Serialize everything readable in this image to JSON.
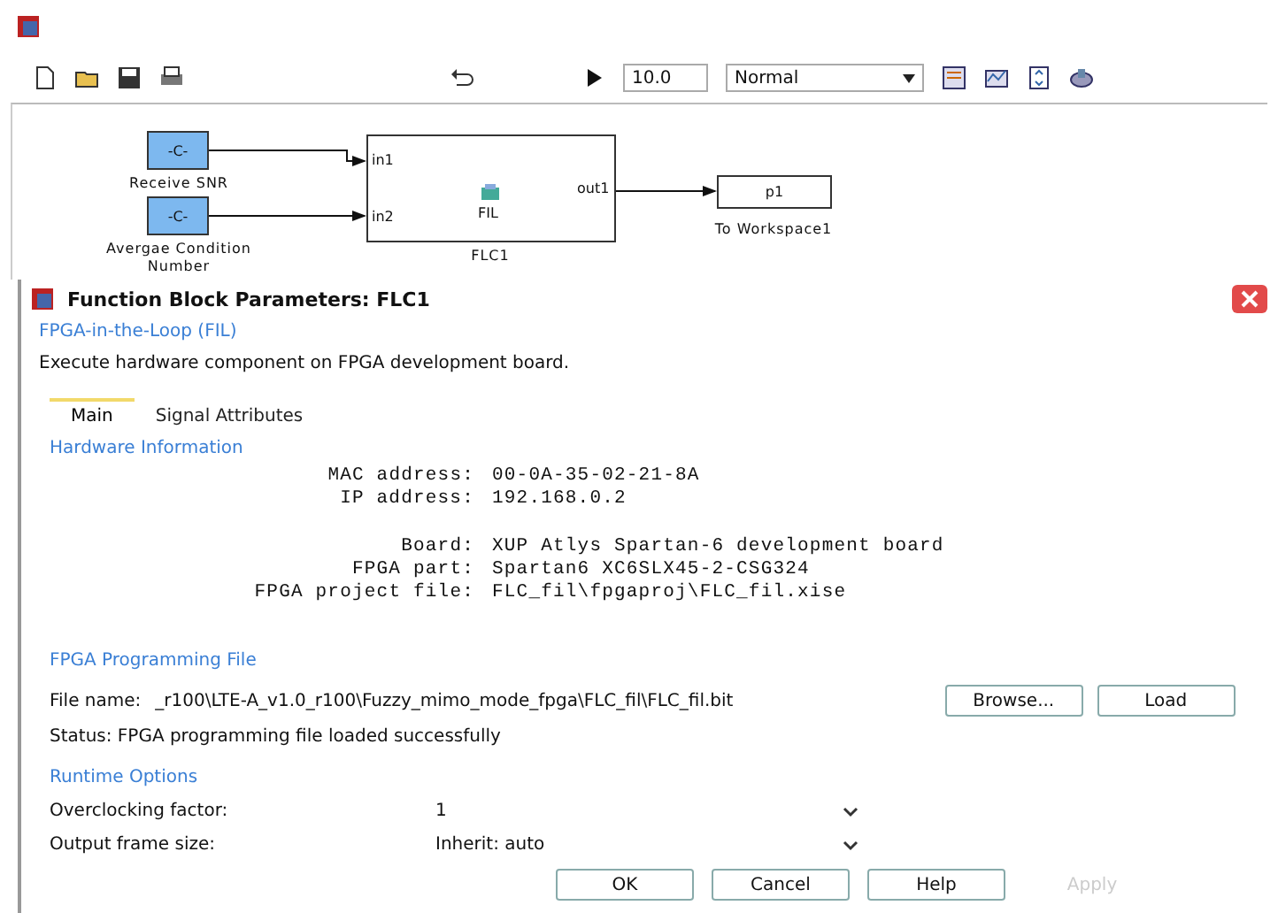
{
  "toolbar": {
    "stop_time": "10.0",
    "sim_mode": "Normal"
  },
  "model": {
    "blocks": [
      {
        "kind": "constant",
        "text": "-C-",
        "label": "Receive SNR"
      },
      {
        "kind": "constant",
        "text": "-C-",
        "label": "Avergae Condition Number"
      },
      {
        "kind": "subsystem",
        "ports_in": [
          "in1",
          "in2"
        ],
        "ports_out": [
          "out1"
        ],
        "icon_label": "FIL",
        "label": "FLC1"
      },
      {
        "kind": "workspace",
        "text": "p1",
        "label": "To Workspace1"
      }
    ]
  },
  "dialog": {
    "title": "Function Block Parameters: FLC1",
    "block_type": "FPGA-in-the-Loop (FIL)",
    "description": "Execute hardware component on FPGA development board.",
    "tabs": [
      {
        "label": "Main",
        "selected": true
      },
      {
        "label": "Signal Attributes",
        "selected": false
      }
    ],
    "hardware": {
      "heading": "Hardware Information",
      "groups": [
        [
          {
            "label": "MAC address:",
            "value": "00-0A-35-02-21-8A"
          },
          {
            "label": "IP address:",
            "value": "192.168.0.2"
          }
        ],
        [
          {
            "label": "Board:",
            "value": "XUP Atlys Spartan-6 development board"
          },
          {
            "label": "FPGA part:",
            "value": "Spartan6 XC6SLX45-2-CSG324"
          },
          {
            "label": "FPGA project file:",
            "value": "FLC_fil\\fpgaproj\\FLC_fil.xise"
          }
        ]
      ]
    },
    "programming": {
      "heading": "FPGA Programming File",
      "file_label": "File name:",
      "file_value": "_r100\\LTE-A_v1.0_r100\\Fuzzy_mimo_mode_fpga\\FLC_fil\\FLC_fil.bit",
      "buttons": [
        "Browse...",
        "Load"
      ],
      "status": "Status: FPGA programming file loaded successfully"
    },
    "runtime": {
      "heading": "Runtime Options",
      "options": [
        {
          "label": "Overclocking factor:",
          "value": "1"
        },
        {
          "label": "Output frame size:",
          "value": "Inherit: auto"
        }
      ]
    },
    "buttons": [
      {
        "label": "OK",
        "disabled": false
      },
      {
        "label": "Cancel",
        "disabled": false
      },
      {
        "label": "Help",
        "disabled": false
      },
      {
        "label": "Apply",
        "disabled": true
      }
    ]
  }
}
